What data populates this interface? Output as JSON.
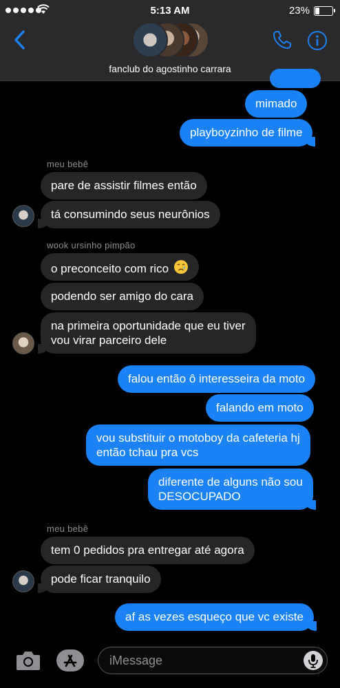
{
  "status_bar": {
    "time": "5:13 AM",
    "battery": "23%",
    "battery_level": 0.23
  },
  "header": {
    "group_name": "fanclub do agostinho carrara"
  },
  "messages": [
    {
      "text": "mimado"
    },
    {
      "text": "playboyzinho de filme"
    },
    {
      "sender": "meu bebê"
    },
    {
      "text": "pare de assistir filmes então"
    },
    {
      "text": "tá consumindo seus neurônios"
    },
    {
      "sender": "wook ursinho pimpão"
    },
    {
      "text": "o preconceito com rico"
    },
    {
      "text": "podendo ser amigo do cara"
    },
    {
      "text": "na primeira oportunidade que eu tiver",
      "text2": "vou virar parceiro dele"
    },
    {
      "text": "falou então ô interesseira da moto"
    },
    {
      "text": "falando em moto"
    },
    {
      "text": "vou substituir o motoboy da cafeteria hj",
      "text2": "então tchau pra vcs"
    },
    {
      "text": "diferente de alguns não sou",
      "text2": "DESOCUPADO"
    },
    {
      "sender": "meu bebê"
    },
    {
      "text": "tem 0 pedidos pra entregar até agora"
    },
    {
      "text": "pode ficar tranquilo"
    },
    {
      "text": "af as vezes esqueço que vc existe"
    }
  ],
  "input": {
    "placeholder": "iMessage"
  },
  "colors": {
    "outgoing": "#1b82f6",
    "incoming": "#262628",
    "accent": "#1b82f6"
  },
  "icons": [
    "back-chevron-icon",
    "phone-icon",
    "info-icon",
    "camera-icon",
    "app-store-icon",
    "microphone-icon",
    "crying-face-emoji"
  ]
}
